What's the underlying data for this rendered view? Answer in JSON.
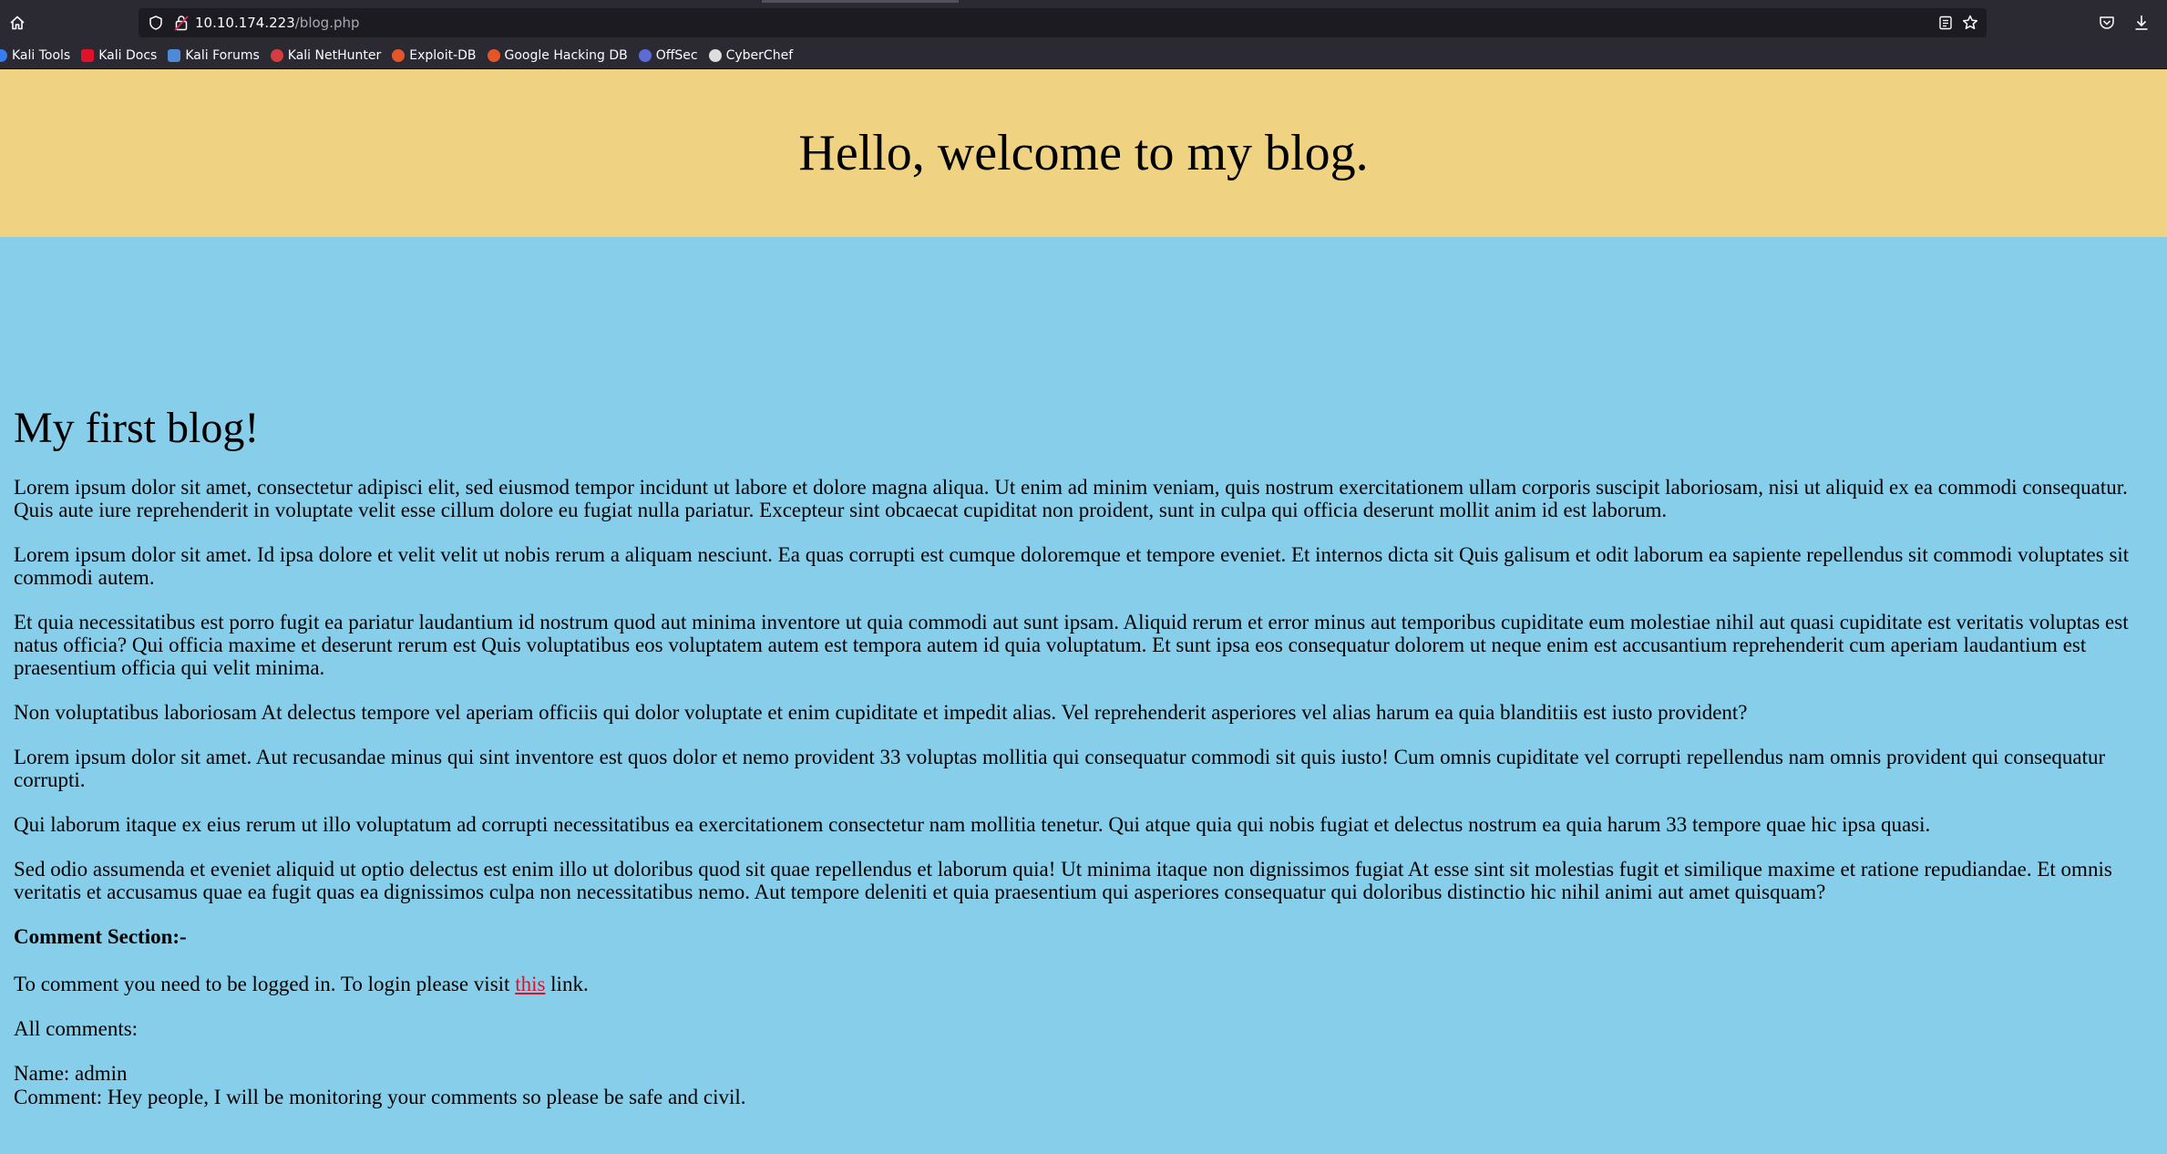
{
  "browser": {
    "url_host": "10.10.174.223",
    "url_path": "/blog.php",
    "bookmarks": [
      {
        "label": "Kali Tools",
        "icon": "kali-tools-icon",
        "color": "#367bf0"
      },
      {
        "label": "Kali Docs",
        "icon": "kali-docs-icon",
        "color": "#e0112b"
      },
      {
        "label": "Kali Forums",
        "icon": "kali-forums-icon",
        "color": "#4f8ad9"
      },
      {
        "label": "Kali NetHunter",
        "icon": "kali-nethunter-icon",
        "color": "#d43e3e"
      },
      {
        "label": "Exploit-DB",
        "icon": "exploit-db-icon",
        "color": "#e5552a"
      },
      {
        "label": "Google Hacking DB",
        "icon": "ghdb-icon",
        "color": "#e5552a"
      },
      {
        "label": "OffSec",
        "icon": "offsec-icon",
        "color": "#5b6cd9"
      },
      {
        "label": "CyberChef",
        "icon": "cyberchef-icon",
        "color": "#dddddd"
      }
    ]
  },
  "page": {
    "header_title": "Hello, welcome to my blog.",
    "blog_title": "My first blog!",
    "paragraphs": [
      "Lorem ipsum dolor sit amet, consectetur adipisci elit, sed eiusmod tempor incidunt ut labore et dolore magna aliqua. Ut enim ad minim veniam, quis nostrum exercitationem ullam corporis suscipit laboriosam, nisi ut aliquid ex ea commodi consequatur. Quis aute iure reprehenderit in voluptate velit esse cillum dolore eu fugiat nulla pariatur. Excepteur sint obcaecat cupiditat non proident, sunt in culpa qui officia deserunt mollit anim id est laborum.",
      "Lorem ipsum dolor sit amet. Id ipsa dolore et velit velit ut nobis rerum a aliquam nesciunt. Ea quas corrupti est cumque doloremque et tempore eveniet. Et internos dicta sit Quis galisum et odit laborum ea sapiente repellendus sit commodi voluptates sit commodi autem.",
      "Et quia necessitatibus est porro fugit ea pariatur laudantium id nostrum quod aut minima inventore ut quia commodi aut sunt ipsam. Aliquid rerum et error minus aut temporibus cupiditate eum molestiae nihil aut quasi cupiditate est veritatis voluptas est natus officia? Qui officia maxime et deserunt rerum est Quis voluptatibus eos voluptatem autem est tempora autem id quia voluptatum. Et sunt ipsa eos consequatur dolorem ut neque enim est accusantium reprehenderit cum aperiam laudantium est praesentium officia qui velit minima.",
      "Non voluptatibus laboriosam At delectus tempore vel aperiam officiis qui dolor voluptate et enim cupiditate et impedit alias. Vel reprehenderit asperiores vel alias harum ea quia blanditiis est iusto provident?",
      "Lorem ipsum dolor sit amet. Aut recusandae minus qui sint inventore est quos dolor et nemo provident 33 voluptas mollitia qui consequatur commodi sit quis iusto! Cum omnis cupiditate vel corrupti repellendus nam omnis provident qui consequatur corrupti.",
      "Qui laborum itaque ex eius rerum ut illo voluptatum ad corrupti necessitatibus ea exercitationem consectetur nam mollitia tenetur. Qui atque quia qui nobis fugiat et delectus nostrum ea quia harum 33 tempore quae hic ipsa quasi.",
      "Sed odio assumenda et eveniet aliquid ut optio delectus est enim illo ut doloribus quod sit quae repellendus et laborum quia! Ut minima itaque non dignissimos fugiat At esse sint sit molestias fugit et similique maxime et ratione repudiandae. Et omnis veritatis et accusamus quae ea fugit quas ea dignissimos culpa non necessitatibus nemo. Aut tempore deleniti et quia praesentium qui asperiores consequatur qui doloribus distinctio hic nihil animi aut amet quisquam?"
    ],
    "comment_section_title": "Comment Section:-",
    "login_prefix": "To comment you need to be logged in. To login please visit ",
    "login_link": "this",
    "login_suffix": " link.",
    "all_comments_label": "All comments:",
    "comments": [
      {
        "name_line": "Name: admin",
        "comment_line": "Comment: Hey people, I will be monitoring your comments so please be safe and civil."
      }
    ]
  },
  "colors": {
    "header_bg": "#f0d382",
    "page_bg": "#87ceeb",
    "link": "#e0112b"
  }
}
